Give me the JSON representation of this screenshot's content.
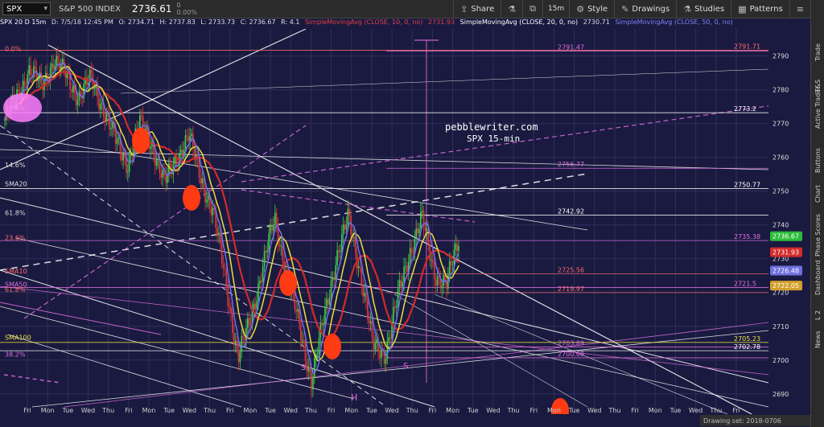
{
  "toolbar": {
    "symbol": "SPX",
    "security_name": "S&P 500 INDEX",
    "last_price": "2736.61",
    "change_abs": "0",
    "change_pct": "0.00%",
    "share_label": "Share",
    "timeframe": "15m",
    "style_label": "Style",
    "drawings_label": "Drawings",
    "studies_label": "Studies",
    "patterns_label": "Patterns"
  },
  "info_line": {
    "symbol_tf": "SPX 20 D 15m",
    "date": "D: 7/5/18 12:45 PM",
    "open": "O: 2734.71",
    "high": "H: 2737.83",
    "low": "L: 2733.73",
    "close": "C: 2736.67",
    "range": "R: 4.1",
    "sma10": "SimpleMovingAvg (CLOSE, 10, 0, no)",
    "sma10_val": "2731.93",
    "sma20": "SimpleMovingAvg (CLOSE, 20, 0, no)",
    "sma20_val": "2730.71",
    "sma50": "SimpleMovingAvg (CLOSE, 50, 0, no)",
    "sma50_val": "2726.48"
  },
  "sidebar": {
    "items": [
      "Trade",
      "T&S",
      "Active Trader",
      "Buttons",
      "Chart",
      "Phase Scores",
      "Dashboard",
      "L 2",
      "News"
    ]
  },
  "status_bar": {
    "drawing_set": "Drawing set: 2018-0706"
  },
  "annotation": {
    "site": "pebblewriter.com",
    "subtitle": "SPX 15-min"
  },
  "pattern_labels": {
    "left_shoulder": "S",
    "head": "H",
    "right_shoulder": "S"
  },
  "chart_data": {
    "type": "candlestick",
    "ylim": [
      2684,
      2798
    ],
    "y_ticks": [
      2690,
      2700,
      2710,
      2720,
      2730,
      2740,
      2750,
      2760,
      2770,
      2780,
      2790
    ],
    "x_ticks": [
      "Fri",
      "Mon",
      "Tue",
      "Wed",
      "Thu",
      "Fri",
      "Mon",
      "Tue",
      "Wed",
      "Thu",
      "Fri",
      "Mon",
      "Tue",
      "Wed",
      "Thu",
      "Fri",
      "Mon",
      "Tue",
      "Wed",
      "Thu",
      "Fri",
      "Mon",
      "Tue",
      "Wed",
      "Thu",
      "Fri",
      "Mon",
      "Tue",
      "Wed",
      "Thu",
      "Fri",
      "Mon",
      "Tue",
      "Wed",
      "Thu",
      "Fri"
    ],
    "price_levels": [
      {
        "label": "2791.71",
        "value": 2791.71,
        "color": "#ff6b6b"
      },
      {
        "label": "2791.47",
        "value": 2791.47,
        "color": "#e070e0"
      },
      {
        "label": "2773.2",
        "value": 2773.2,
        "color": "#ffffff"
      },
      {
        "label": "2756.77",
        "value": 2756.77,
        "color": "#e070e0"
      },
      {
        "label": "2750.77",
        "value": 2750.77,
        "color": "#ffffff"
      },
      {
        "label": "2742.92",
        "value": 2742.92,
        "color": "#ffffff"
      },
      {
        "label": "2735.38",
        "value": 2735.38,
        "color": "#e070e0"
      },
      {
        "label": "2725.56",
        "value": 2725.56,
        "color": "#ff6b6b"
      },
      {
        "label": "2721.5",
        "value": 2721.5,
        "color": "#e070e0"
      },
      {
        "label": "2719.97",
        "value": 2719.97,
        "color": "#ff6b6b"
      },
      {
        "label": "2705.23",
        "value": 2705.23,
        "color": "#e8e040"
      },
      {
        "label": "2703.89",
        "value": 2703.89,
        "color": "#e070e0"
      },
      {
        "label": "2702.78",
        "value": 2702.78,
        "color": "#ffffff"
      },
      {
        "label": "2700.68",
        "value": 2700.68,
        "color": "#e070e0"
      }
    ],
    "fib_labels": [
      {
        "label": "0.0%",
        "value": 2791.0,
        "color": "#ff6b6b"
      },
      {
        "label": "76.4%",
        "value": 2773.4,
        "color": "#dddddd"
      },
      {
        "label": "14.6%",
        "value": 2756.6,
        "color": "#dddddd"
      },
      {
        "label": "SMA20",
        "value": 2751.0,
        "color": "#dddddd"
      },
      {
        "label": "61.8%",
        "value": 2742.4,
        "color": "#dddddd"
      },
      {
        "label": "23.6%",
        "value": 2735.0,
        "color": "#ff6b6b"
      },
      {
        "label": "SMA10",
        "value": 2725.2,
        "color": "#ff6b6b"
      },
      {
        "label": "SMA50",
        "value": 2721.3,
        "color": "#e070e0"
      },
      {
        "label": "61.8%",
        "value": 2719.7,
        "color": "#ff6b6b"
      },
      {
        "label": "SMA100",
        "value": 2705.5,
        "color": "#e8e040"
      },
      {
        "label": "38.2%",
        "value": 2700.6,
        "color": "#e070e0"
      }
    ],
    "axis_badges": [
      {
        "label": "2736.67",
        "value": 2736.67,
        "color": "#2bbd3a"
      },
      {
        "label": "2731.93",
        "value": 2731.93,
        "color": "#d32a2a"
      },
      {
        "label": "2726.48",
        "value": 2726.48,
        "color": "#6f6fe0"
      },
      {
        "label": "2722.05",
        "value": 2722.05,
        "color": "#d1a02a"
      }
    ],
    "series": [
      {
        "name": "SMA10",
        "color": "#d32a2a"
      },
      {
        "name": "SMA20",
        "color": "#e8e040"
      },
      {
        "name": "SMA50",
        "color": "#7070e8"
      }
    ],
    "price_path": [
      2771,
      2778,
      2786,
      2781,
      2789,
      2784,
      2778,
      2783,
      2775,
      2765,
      2758,
      2770,
      2764,
      2752,
      2760,
      2766,
      2754,
      2743,
      2724,
      2700,
      2712,
      2727,
      2742,
      2725,
      2710,
      2694,
      2712,
      2730,
      2742,
      2726,
      2704,
      2702,
      2718,
      2732,
      2742,
      2726,
      2722,
      2736
    ]
  }
}
